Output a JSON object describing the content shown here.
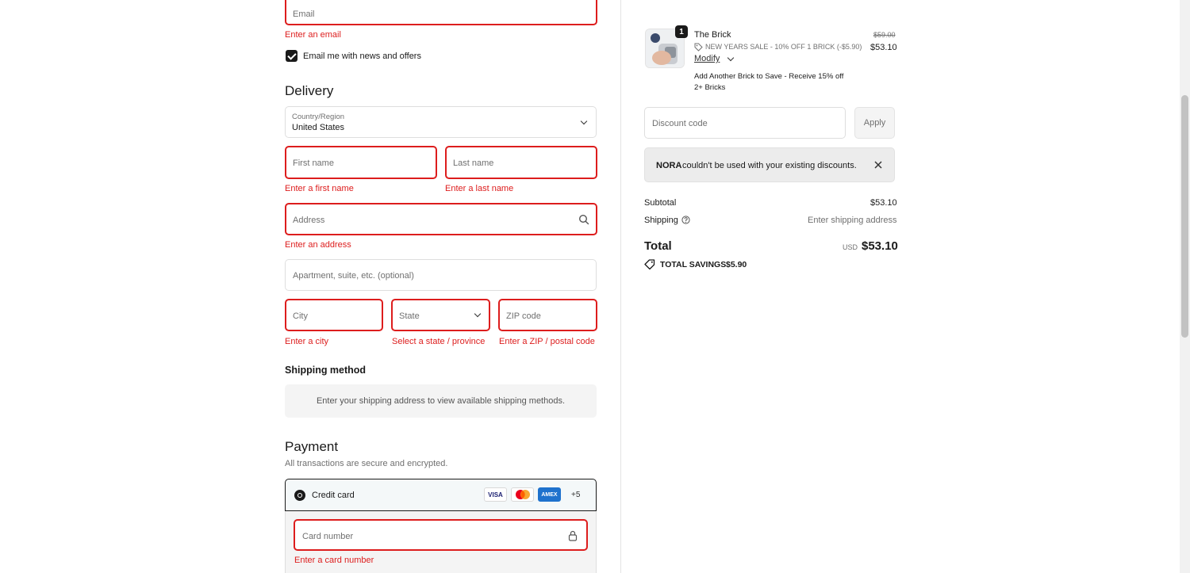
{
  "contact": {
    "email_placeholder": "Email",
    "email_error": "Enter an email",
    "newsletter_label": "Email me with news and offers"
  },
  "delivery": {
    "heading": "Delivery",
    "country_label": "Country/Region",
    "country_value": "United States",
    "first_name_placeholder": "First name",
    "first_name_error": "Enter a first name",
    "last_name_placeholder": "Last name",
    "last_name_error": "Enter a last name",
    "address_placeholder": "Address",
    "address_error": "Enter an address",
    "apartment_placeholder": "Apartment, suite, etc. (optional)",
    "city_placeholder": "City",
    "city_error": "Enter a city",
    "state_placeholder": "State",
    "state_error": "Select a state / province",
    "zip_placeholder": "ZIP code",
    "zip_error": "Enter a ZIP / postal code"
  },
  "shipping_method": {
    "heading": "Shipping method",
    "message": "Enter your shipping address to view available shipping methods."
  },
  "payment": {
    "heading": "Payment",
    "subtitle": "All transactions are secure and encrypted.",
    "method_label": "Credit card",
    "card_logos": [
      "VISA",
      "",
      "AMEX"
    ],
    "more_cards": "+5",
    "card_number_placeholder": "Card number",
    "card_number_error": "Enter a card number"
  },
  "summary": {
    "product_name": "The Brick",
    "quantity": "1",
    "discount_line": "NEW YEARS SALE - 10% OFF 1 BRICK (-$5.90)",
    "modify_label": "Modify",
    "original_price": "$59.00",
    "price": "$53.10",
    "upsell": "Add Another Brick to Save - Receive 15% off 2+ Bricks",
    "discount_placeholder": "Discount code",
    "apply_label": "Apply",
    "notice_code": "NORA",
    "notice_text": "couldn't be used with your existing discounts.",
    "subtotal_label": "Subtotal",
    "subtotal_value": "$53.10",
    "shipping_label": "Shipping",
    "shipping_value": "Enter shipping address",
    "total_label": "Total",
    "currency": "USD",
    "total_value": "$53.10",
    "savings_label": "TOTAL SAVINGS",
    "savings_value": "$5.90"
  },
  "colors": {
    "error": "#dd1d1d",
    "text": "#1a1a1a",
    "muted": "#707070"
  }
}
